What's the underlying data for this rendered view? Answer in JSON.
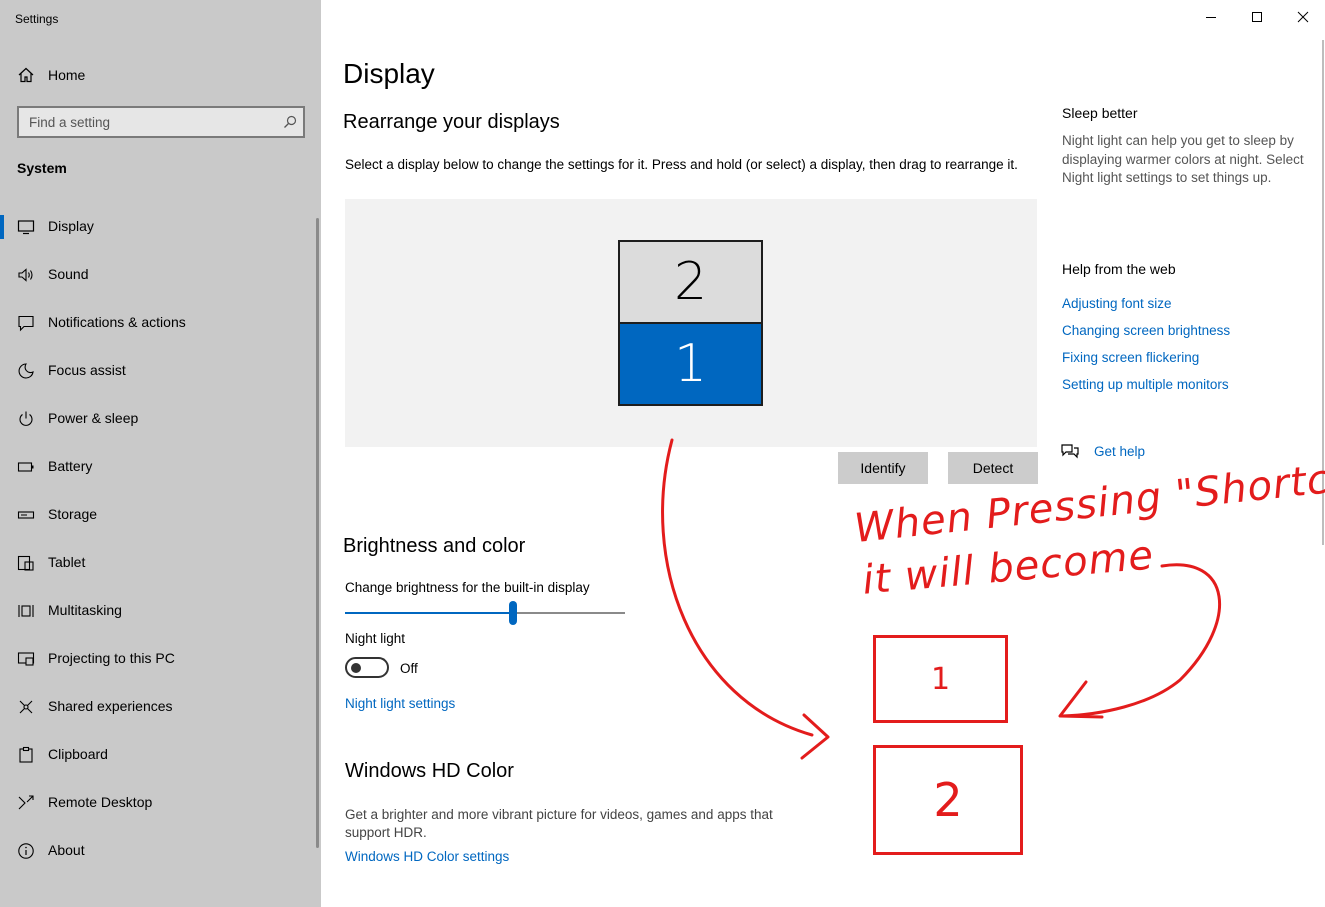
{
  "window": {
    "title": "Settings",
    "minimize_icon": "minimize-icon",
    "maximize_icon": "maximize-icon",
    "close_icon": "close-icon"
  },
  "sidebar": {
    "home": {
      "label": "Home",
      "icon": "home-icon"
    },
    "search": {
      "placeholder": "Find a setting",
      "value": "",
      "icon": "search-icon"
    },
    "section": "System",
    "items": [
      {
        "label": "Display",
        "icon": "monitor-icon",
        "active": true
      },
      {
        "label": "Sound",
        "icon": "speaker-icon"
      },
      {
        "label": "Notifications & actions",
        "icon": "notification-icon"
      },
      {
        "label": "Focus assist",
        "icon": "moon-icon"
      },
      {
        "label": "Power & sleep",
        "icon": "power-icon"
      },
      {
        "label": "Battery",
        "icon": "battery-icon"
      },
      {
        "label": "Storage",
        "icon": "storage-icon"
      },
      {
        "label": "Tablet",
        "icon": "tablet-icon"
      },
      {
        "label": "Multitasking",
        "icon": "multitasking-icon"
      },
      {
        "label": "Projecting to this PC",
        "icon": "projecting-icon"
      },
      {
        "label": "Shared experiences",
        "icon": "shared-experiences-icon"
      },
      {
        "label": "Clipboard",
        "icon": "clipboard-icon"
      },
      {
        "label": "Remote Desktop",
        "icon": "remote-desktop-icon"
      },
      {
        "label": "About",
        "icon": "info-icon"
      }
    ]
  },
  "main": {
    "title": "Display",
    "rearrange": {
      "heading": "Rearrange your displays",
      "description": "Select a display below to change the settings for it. Press and hold (or select) a display, then drag to rearrange it.",
      "monitor_top": "2",
      "monitor_bottom": "1",
      "identify_label": "Identify",
      "detect_label": "Detect"
    },
    "brightness": {
      "heading": "Brightness and color",
      "slider_label": "Change brightness for the built-in display",
      "slider_value": 0.6,
      "night_light_label": "Night light",
      "night_light_state": "Off",
      "night_light_settings_link": "Night light settings"
    },
    "hdr": {
      "heading": "Windows HD Color",
      "description": "Get a brighter and more vibrant picture for videos, games and apps that support HDR.",
      "link": "Windows HD Color settings"
    }
  },
  "right_panel": {
    "sleep_heading": "Sleep better",
    "sleep_text": "Night light can help you get to sleep by displaying warmer colors at night. Select Night light settings to set things up.",
    "help_heading": "Help from the web",
    "links": [
      "Adjusting font size",
      "Changing screen brightness",
      "Fixing screen flickering",
      "Setting up multiple monitors"
    ],
    "get_help": "Get help",
    "get_help_icon": "chat-help-icon"
  },
  "annotation": {
    "line1": "When Pressing \"Shortcut\"",
    "line2": "it will become",
    "box_top": "1",
    "box_bottom": "2",
    "color": "#e31c1c"
  },
  "colors": {
    "accent": "#0067c0",
    "sidebar_bg": "#c9c9c9",
    "annotation": "#e31c1c"
  }
}
